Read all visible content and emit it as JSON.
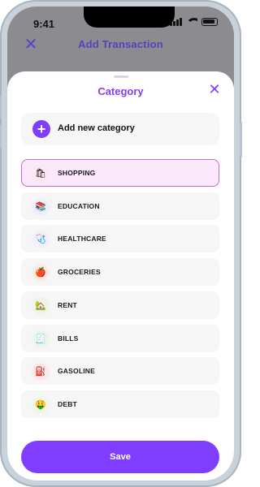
{
  "status_bar": {
    "time": "9:41"
  },
  "app_header": {
    "title": "Add  Transaction",
    "close_symbol": "✕"
  },
  "sheet": {
    "title": "Category",
    "close_symbol": "✕",
    "add_button": {
      "label": "Add new category",
      "symbol": "+"
    },
    "categories": [
      {
        "label": "SHOPPING",
        "icon": "shopping-bag-icon",
        "glyph": "🛍",
        "bg": "#fde6f2",
        "selected": true
      },
      {
        "label": "EDUCATION",
        "icon": "books-icon",
        "glyph": "📚",
        "bg": "#eeeef7",
        "selected": false
      },
      {
        "label": "HEALTHCARE",
        "icon": "stethoscope-icon",
        "glyph": "🩺",
        "bg": "#f3eefa",
        "selected": false
      },
      {
        "label": "GROCERIES",
        "icon": "apple-icon",
        "glyph": "🍎",
        "bg": "#fdece4",
        "selected": false
      },
      {
        "label": "RENT",
        "icon": "house-icon",
        "glyph": "🏡",
        "bg": "#eef4e8",
        "selected": false
      },
      {
        "label": "BILLS",
        "icon": "receipt-icon",
        "glyph": "🧾",
        "bg": "#eaf5ea",
        "selected": false
      },
      {
        "label": "GASOLINE",
        "icon": "fuel-pump-icon",
        "glyph": "⛽",
        "bg": "#fde8e8",
        "selected": false
      },
      {
        "label": "DEBT",
        "icon": "money-face-icon",
        "glyph": "🤑",
        "bg": "#eef7e6",
        "selected": false
      }
    ],
    "save_label": "Save"
  },
  "colors": {
    "accent": "#7f3dff",
    "header_accent": "#5a3fc0",
    "selected_border": "#c86ac8"
  }
}
